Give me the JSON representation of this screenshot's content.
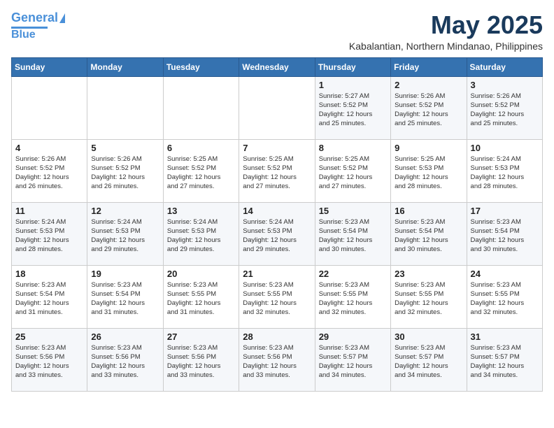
{
  "header": {
    "logo_line1": "General",
    "logo_line2": "Blue",
    "month": "May 2025",
    "location": "Kabalantian, Northern Mindanao, Philippines"
  },
  "weekdays": [
    "Sunday",
    "Monday",
    "Tuesday",
    "Wednesday",
    "Thursday",
    "Friday",
    "Saturday"
  ],
  "weeks": [
    [
      {
        "day": "",
        "info": ""
      },
      {
        "day": "",
        "info": ""
      },
      {
        "day": "",
        "info": ""
      },
      {
        "day": "",
        "info": ""
      },
      {
        "day": "1",
        "info": "Sunrise: 5:27 AM\nSunset: 5:52 PM\nDaylight: 12 hours\nand 25 minutes."
      },
      {
        "day": "2",
        "info": "Sunrise: 5:26 AM\nSunset: 5:52 PM\nDaylight: 12 hours\nand 25 minutes."
      },
      {
        "day": "3",
        "info": "Sunrise: 5:26 AM\nSunset: 5:52 PM\nDaylight: 12 hours\nand 25 minutes."
      }
    ],
    [
      {
        "day": "4",
        "info": "Sunrise: 5:26 AM\nSunset: 5:52 PM\nDaylight: 12 hours\nand 26 minutes."
      },
      {
        "day": "5",
        "info": "Sunrise: 5:26 AM\nSunset: 5:52 PM\nDaylight: 12 hours\nand 26 minutes."
      },
      {
        "day": "6",
        "info": "Sunrise: 5:25 AM\nSunset: 5:52 PM\nDaylight: 12 hours\nand 27 minutes."
      },
      {
        "day": "7",
        "info": "Sunrise: 5:25 AM\nSunset: 5:52 PM\nDaylight: 12 hours\nand 27 minutes."
      },
      {
        "day": "8",
        "info": "Sunrise: 5:25 AM\nSunset: 5:52 PM\nDaylight: 12 hours\nand 27 minutes."
      },
      {
        "day": "9",
        "info": "Sunrise: 5:25 AM\nSunset: 5:53 PM\nDaylight: 12 hours\nand 28 minutes."
      },
      {
        "day": "10",
        "info": "Sunrise: 5:24 AM\nSunset: 5:53 PM\nDaylight: 12 hours\nand 28 minutes."
      }
    ],
    [
      {
        "day": "11",
        "info": "Sunrise: 5:24 AM\nSunset: 5:53 PM\nDaylight: 12 hours\nand 28 minutes."
      },
      {
        "day": "12",
        "info": "Sunrise: 5:24 AM\nSunset: 5:53 PM\nDaylight: 12 hours\nand 29 minutes."
      },
      {
        "day": "13",
        "info": "Sunrise: 5:24 AM\nSunset: 5:53 PM\nDaylight: 12 hours\nand 29 minutes."
      },
      {
        "day": "14",
        "info": "Sunrise: 5:24 AM\nSunset: 5:53 PM\nDaylight: 12 hours\nand 29 minutes."
      },
      {
        "day": "15",
        "info": "Sunrise: 5:23 AM\nSunset: 5:54 PM\nDaylight: 12 hours\nand 30 minutes."
      },
      {
        "day": "16",
        "info": "Sunrise: 5:23 AM\nSunset: 5:54 PM\nDaylight: 12 hours\nand 30 minutes."
      },
      {
        "day": "17",
        "info": "Sunrise: 5:23 AM\nSunset: 5:54 PM\nDaylight: 12 hours\nand 30 minutes."
      }
    ],
    [
      {
        "day": "18",
        "info": "Sunrise: 5:23 AM\nSunset: 5:54 PM\nDaylight: 12 hours\nand 31 minutes."
      },
      {
        "day": "19",
        "info": "Sunrise: 5:23 AM\nSunset: 5:54 PM\nDaylight: 12 hours\nand 31 minutes."
      },
      {
        "day": "20",
        "info": "Sunrise: 5:23 AM\nSunset: 5:55 PM\nDaylight: 12 hours\nand 31 minutes."
      },
      {
        "day": "21",
        "info": "Sunrise: 5:23 AM\nSunset: 5:55 PM\nDaylight: 12 hours\nand 32 minutes."
      },
      {
        "day": "22",
        "info": "Sunrise: 5:23 AM\nSunset: 5:55 PM\nDaylight: 12 hours\nand 32 minutes."
      },
      {
        "day": "23",
        "info": "Sunrise: 5:23 AM\nSunset: 5:55 PM\nDaylight: 12 hours\nand 32 minutes."
      },
      {
        "day": "24",
        "info": "Sunrise: 5:23 AM\nSunset: 5:55 PM\nDaylight: 12 hours\nand 32 minutes."
      }
    ],
    [
      {
        "day": "25",
        "info": "Sunrise: 5:23 AM\nSunset: 5:56 PM\nDaylight: 12 hours\nand 33 minutes."
      },
      {
        "day": "26",
        "info": "Sunrise: 5:23 AM\nSunset: 5:56 PM\nDaylight: 12 hours\nand 33 minutes."
      },
      {
        "day": "27",
        "info": "Sunrise: 5:23 AM\nSunset: 5:56 PM\nDaylight: 12 hours\nand 33 minutes."
      },
      {
        "day": "28",
        "info": "Sunrise: 5:23 AM\nSunset: 5:56 PM\nDaylight: 12 hours\nand 33 minutes."
      },
      {
        "day": "29",
        "info": "Sunrise: 5:23 AM\nSunset: 5:57 PM\nDaylight: 12 hours\nand 34 minutes."
      },
      {
        "day": "30",
        "info": "Sunrise: 5:23 AM\nSunset: 5:57 PM\nDaylight: 12 hours\nand 34 minutes."
      },
      {
        "day": "31",
        "info": "Sunrise: 5:23 AM\nSunset: 5:57 PM\nDaylight: 12 hours\nand 34 minutes."
      }
    ]
  ]
}
